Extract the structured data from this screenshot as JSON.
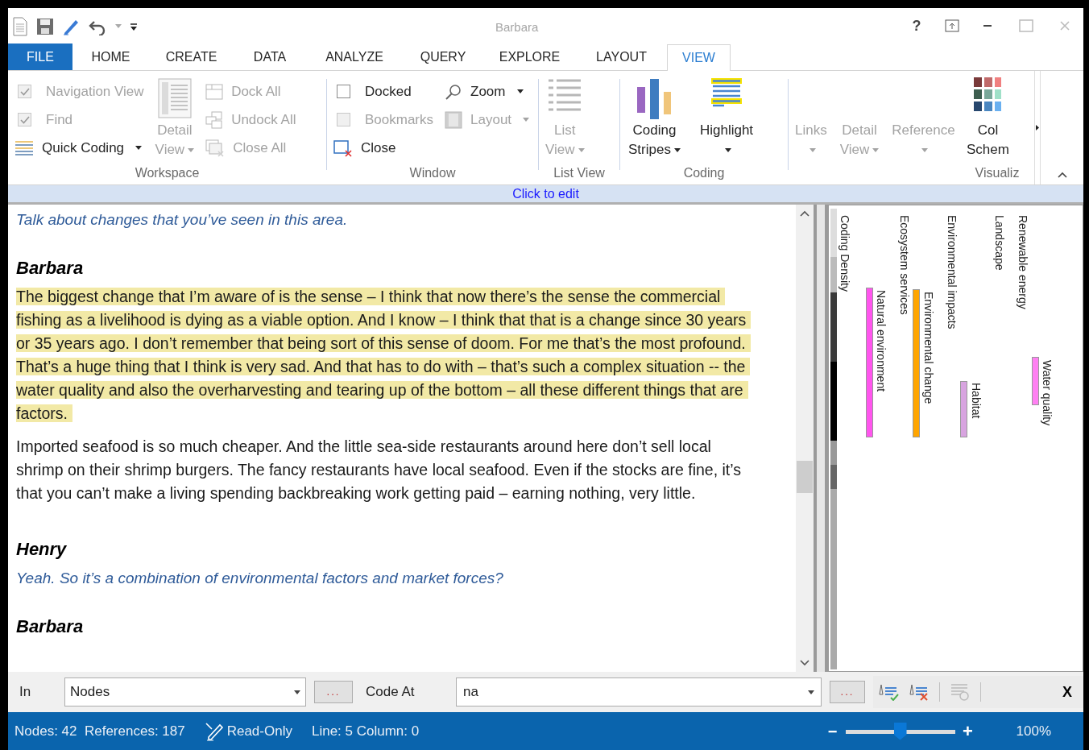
{
  "window": {
    "title": "Barbara",
    "help": "?"
  },
  "tabs": [
    {
      "label": "FILE",
      "kind": "file",
      "selected": false
    },
    {
      "label": "HOME",
      "kind": "tab",
      "selected": false
    },
    {
      "label": "CREATE",
      "kind": "tab",
      "selected": false
    },
    {
      "label": "DATA",
      "kind": "tab",
      "selected": false
    },
    {
      "label": "ANALYZE",
      "kind": "tab",
      "selected": false
    },
    {
      "label": "QUERY",
      "kind": "tab",
      "selected": false
    },
    {
      "label": "EXPLORE",
      "kind": "tab",
      "selected": false
    },
    {
      "label": "LAYOUT",
      "kind": "tab",
      "selected": false
    },
    {
      "label": "VIEW",
      "kind": "tab",
      "selected": true
    }
  ],
  "ribbon": {
    "groups": [
      {
        "label": "Workspace",
        "columns": [
          [
            {
              "kind": "check",
              "label": "Navigation View",
              "checked": true,
              "disabled": true
            },
            {
              "kind": "check",
              "label": "Find",
              "checked": true,
              "disabled": true
            },
            {
              "kind": "small",
              "label": "Quick Coding",
              "disabled": false,
              "dropdown": true
            }
          ],
          [
            {
              "kind": "large",
              "lines": [
                "Detail",
                "View"
              ],
              "disabled": true,
              "dropdown": true
            }
          ],
          [
            {
              "kind": "small",
              "label": "Dock All",
              "disabled": true,
              "dropdown": false
            },
            {
              "kind": "small",
              "label": "Undock All",
              "disabled": true,
              "dropdown": false
            },
            {
              "kind": "small",
              "label": "Close All",
              "disabled": true,
              "dropdown": false
            }
          ]
        ]
      },
      {
        "label": "Window",
        "columns": [
          [
            {
              "kind": "check",
              "label": "Docked",
              "checked": false,
              "disabled": false
            },
            {
              "kind": "check",
              "label": "Bookmarks",
              "checked": false,
              "disabled": true
            },
            {
              "kind": "small",
              "label": "Close",
              "disabled": false,
              "dropdown": false
            }
          ],
          [
            {
              "kind": "small",
              "label": "Zoom",
              "disabled": false,
              "dropdown": true
            },
            {
              "kind": "small",
              "label": "Layout",
              "disabled": true,
              "dropdown": true
            }
          ]
        ]
      },
      {
        "label": "List View",
        "columns": [
          [
            {
              "kind": "large",
              "lines": [
                "List",
                "View"
              ],
              "disabled": true,
              "dropdown": true
            }
          ]
        ]
      },
      {
        "label": "Coding",
        "columns": [
          [
            {
              "kind": "large",
              "lines": [
                "Coding",
                "Stripes"
              ],
              "disabled": false,
              "dropdown": true
            }
          ],
          [
            {
              "kind": "large",
              "lines": [
                "Highlight"
              ],
              "disabled": false,
              "dropdown": true
            }
          ]
        ]
      },
      {
        "columns": [
          [
            {
              "kind": "large",
              "lines": [
                "Links"
              ],
              "disabled": true,
              "dropdown": true
            }
          ],
          [
            {
              "kind": "large",
              "lines": [
                "Detail",
                "View"
              ],
              "disabled": true,
              "dropdown": true
            }
          ],
          [
            {
              "kind": "large",
              "lines": [
                "Reference"
              ],
              "disabled": true,
              "dropdown": true
            }
          ]
        ]
      },
      {
        "label": "Visualiz",
        "columns": [
          [
            {
              "kind": "large",
              "lines": [
                "Col",
                "Schem"
              ],
              "disabled": false,
              "dropdown": false
            }
          ]
        ]
      }
    ]
  },
  "edit_bar": {
    "text": "Click to edit"
  },
  "transcript": [
    {
      "kind": "question",
      "text": "Talk about changes that you’ve seen in this area."
    },
    {
      "kind": "speaker",
      "text": "Barbara"
    },
    {
      "kind": "answer",
      "highlighted": true,
      "text": "The biggest change that I’m aware of is the sense – I think that now there’s the sense the commercial fishing as a livelihood is dying as a viable option. And I know – I think that that is a change since 30 years or 35 years ago. I don’t remember that being sort of this sense of doom. For me that’s the most profound. That’s a huge thing that I think is very sad. And that has to do with – that’s such a complex situation -- the water quality and also the overharvesting and tearing up of the bottom – all these different things that are factors."
    },
    {
      "kind": "answer",
      "highlighted": false,
      "text": "Imported seafood is so much cheaper. And the little sea-side restaurants around here don’t sell local shrimp on their shrimp burgers. The fancy restaurants have local seafood. Even if the stocks are fine, it’s that you can’t make a living spending backbreaking work getting paid – earning nothing, very little."
    },
    {
      "kind": "speaker",
      "text": "Henry"
    },
    {
      "kind": "question",
      "text": "Yeah. So it’s a combination of environmental factors and market forces?"
    },
    {
      "kind": "speaker",
      "text": "Barbara"
    }
  ],
  "coding_stripes": [
    {
      "kind": "density",
      "name": "Coding Density"
    },
    {
      "kind": "bar",
      "name": "Natural environment",
      "color": "#ff55ee"
    },
    {
      "kind": "label",
      "name": "Ecosystem services"
    },
    {
      "kind": "bar",
      "name": "Environmental change",
      "color": "#ffa500"
    },
    {
      "kind": "label",
      "name": "Environmental impacts"
    },
    {
      "kind": "bar",
      "name": "Habitat",
      "color": "#d8a4e0"
    },
    {
      "kind": "label",
      "name": "Landscape"
    },
    {
      "kind": "label",
      "name": "Renewable energy"
    },
    {
      "kind": "bar",
      "name": "Water quality",
      "color": "#ff80f2"
    }
  ],
  "coding_bar": {
    "in_label": "In",
    "in_value": "Nodes",
    "browse": "...",
    "code_at_label": "Code At",
    "code_at_value": "na",
    "browse_2": "...",
    "close": "X"
  },
  "status_bar": {
    "counts": "Nodes: 42  References: 187",
    "mode": "Read-Only",
    "position": "Line: 5 Column: 0",
    "zoom": {
      "out": "−",
      "in": "+",
      "level": 0.5,
      "percent": "100%"
    }
  }
}
